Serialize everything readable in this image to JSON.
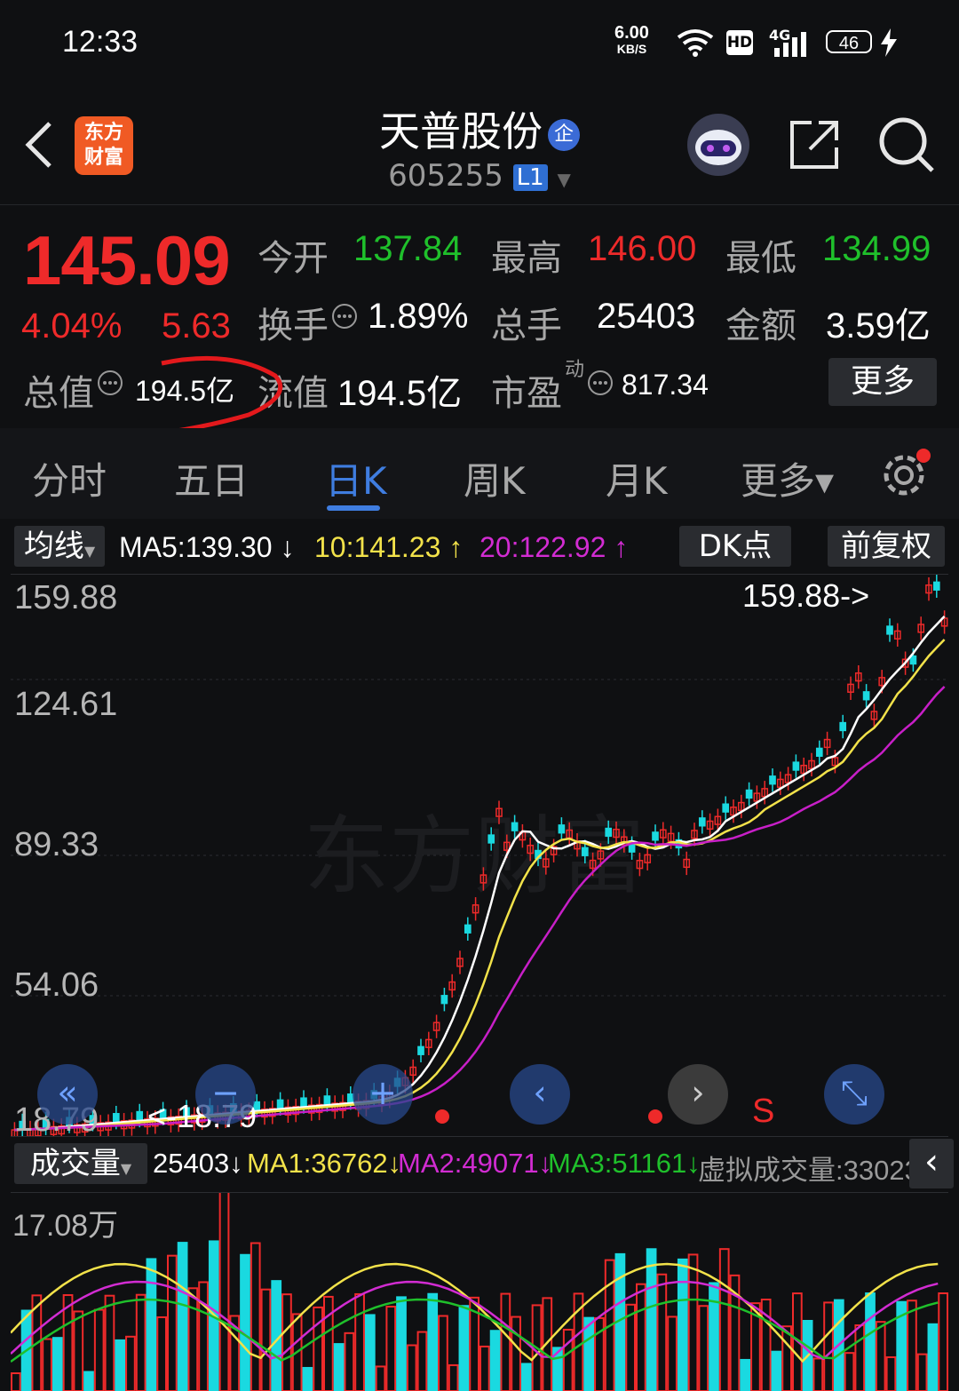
{
  "status": {
    "time": "12:33",
    "net_speed": "6.00",
    "net_unit": "KB/S",
    "hd": "HD",
    "network": "4G",
    "battery": "46"
  },
  "header": {
    "logo_line1": "东方",
    "logo_line2": "财富",
    "stock_name": "天普股份",
    "qi_badge": "企",
    "stock_code": "605255",
    "level": "L1"
  },
  "quote": {
    "price": "145.09",
    "change_pct": "4.04%",
    "change": "5.63",
    "open_label": "今开",
    "open": "137.84",
    "high_label": "最高",
    "high": "146.00",
    "low_label": "最低",
    "low": "134.99",
    "turnover_label": "换手",
    "turnover": "1.89%",
    "volume_label": "总手",
    "volume": "25403",
    "amount_label": "金额",
    "amount": "3.59亿",
    "total_value_label": "总值",
    "total_value": "194.5亿",
    "float_value_label": "流值",
    "float_value": "194.5亿",
    "pe_label": "市盈",
    "pe_sup": "动",
    "pe": "817.34",
    "more": "更多"
  },
  "tabs": [
    {
      "label": "分时"
    },
    {
      "label": "五日"
    },
    {
      "label": "日K"
    },
    {
      "label": "周K"
    },
    {
      "label": "月K"
    },
    {
      "label": "更多▾"
    }
  ],
  "ma_bar": {
    "indicator": "均线",
    "ma5": "MA5:139.30 ↓",
    "ma10": "10:141.23 ↑",
    "ma20": "20:122.92 ↑",
    "dk": "DK点",
    "adjust": "前复权"
  },
  "price_chart": {
    "y_labels": [
      "159.88",
      "124.61",
      "89.33",
      "54.06",
      "18.79"
    ],
    "max_note": "159.88->",
    "min_note": "<-18.79",
    "signal": "S",
    "colors": {
      "up": "#ee2a2a",
      "down": "#1ad9e0",
      "ma5": "#ffffff",
      "ma10": "#f2e24a",
      "ma20": "#c81fc8"
    }
  },
  "vol_bar": {
    "label": "成交量",
    "vol": "25403↓",
    "ma1": "MA1:36762↓",
    "ma2": "MA2:49071↓",
    "ma3": "MA3:51161↓",
    "virtual": "虚拟成交量:33023"
  },
  "vol_chart": {
    "y_label": "17.08万"
  }
}
